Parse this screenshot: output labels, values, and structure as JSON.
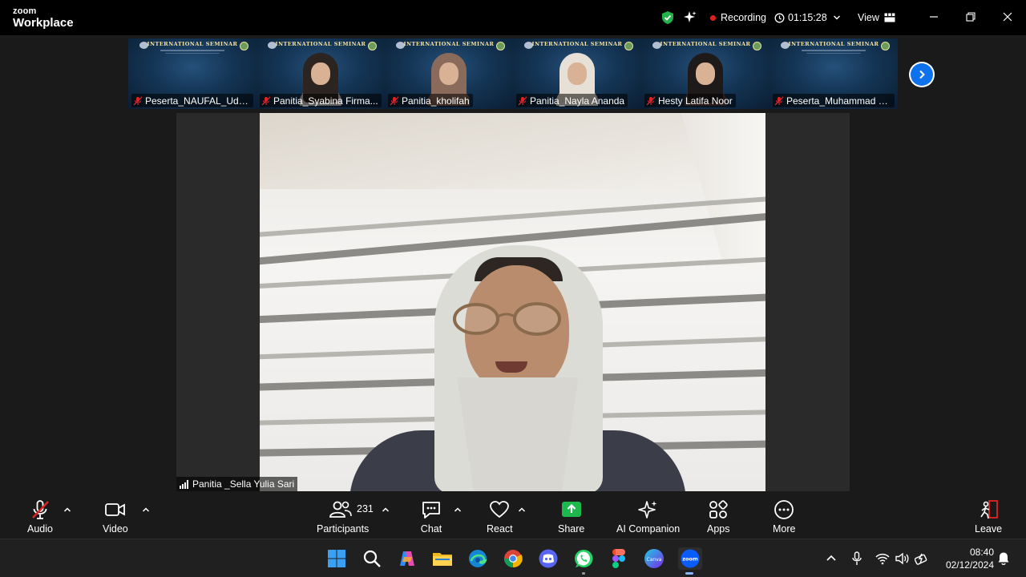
{
  "titlebar": {
    "brand_line1": "zoom",
    "brand_line2": "Workplace",
    "recording_label": "Recording",
    "timer": "01:15:28",
    "view_label": "View"
  },
  "gallery": {
    "banner_title": "INTERNATIONAL SEMINAR",
    "tiles": [
      {
        "name": "Peserta_NAUFAL_Udin...",
        "has_video": false
      },
      {
        "name": "Panitia_Syabina Firma...",
        "has_video": true,
        "hijab_color": "#2c2420",
        "body_color": "#d5d0cc"
      },
      {
        "name": "Panitia_kholifah",
        "has_video": true,
        "hijab_color": "#8a6a5a",
        "body_color": "#7a5b4c"
      },
      {
        "name": "Panitia_Nayla Ananda",
        "has_video": true,
        "hijab_color": "#e6e0d6",
        "body_color": "#e9e4dc"
      },
      {
        "name": "Hesty Latifa Noor",
        "has_video": true,
        "hijab_color": "#1e1a1a",
        "body_color": "#5b3f3a"
      },
      {
        "name": "Peserta_Muhammad N...",
        "has_video": false
      }
    ]
  },
  "main_video": {
    "speaker_name": "Panitia _Sella Yulia Sari"
  },
  "toolbar": {
    "audio_label": "Audio",
    "video_label": "Video",
    "participants_label": "Participants",
    "participants_count": "231",
    "chat_label": "Chat",
    "react_label": "React",
    "share_label": "Share",
    "ai_label": "AI Companion",
    "apps_label": "Apps",
    "more_label": "More",
    "leave_label": "Leave"
  },
  "colors": {
    "accent": "#0e72ed",
    "share_green": "#1fb84f",
    "muted_red": "#e02424",
    "leave_red": "#e02424"
  },
  "taskbar": {
    "apps": [
      "windows-start",
      "search",
      "copilot",
      "file-explorer",
      "edge",
      "chrome",
      "discord",
      "whatsapp",
      "figma",
      "canva",
      "zoom"
    ],
    "time": "08:40",
    "date": "02/12/2024"
  }
}
